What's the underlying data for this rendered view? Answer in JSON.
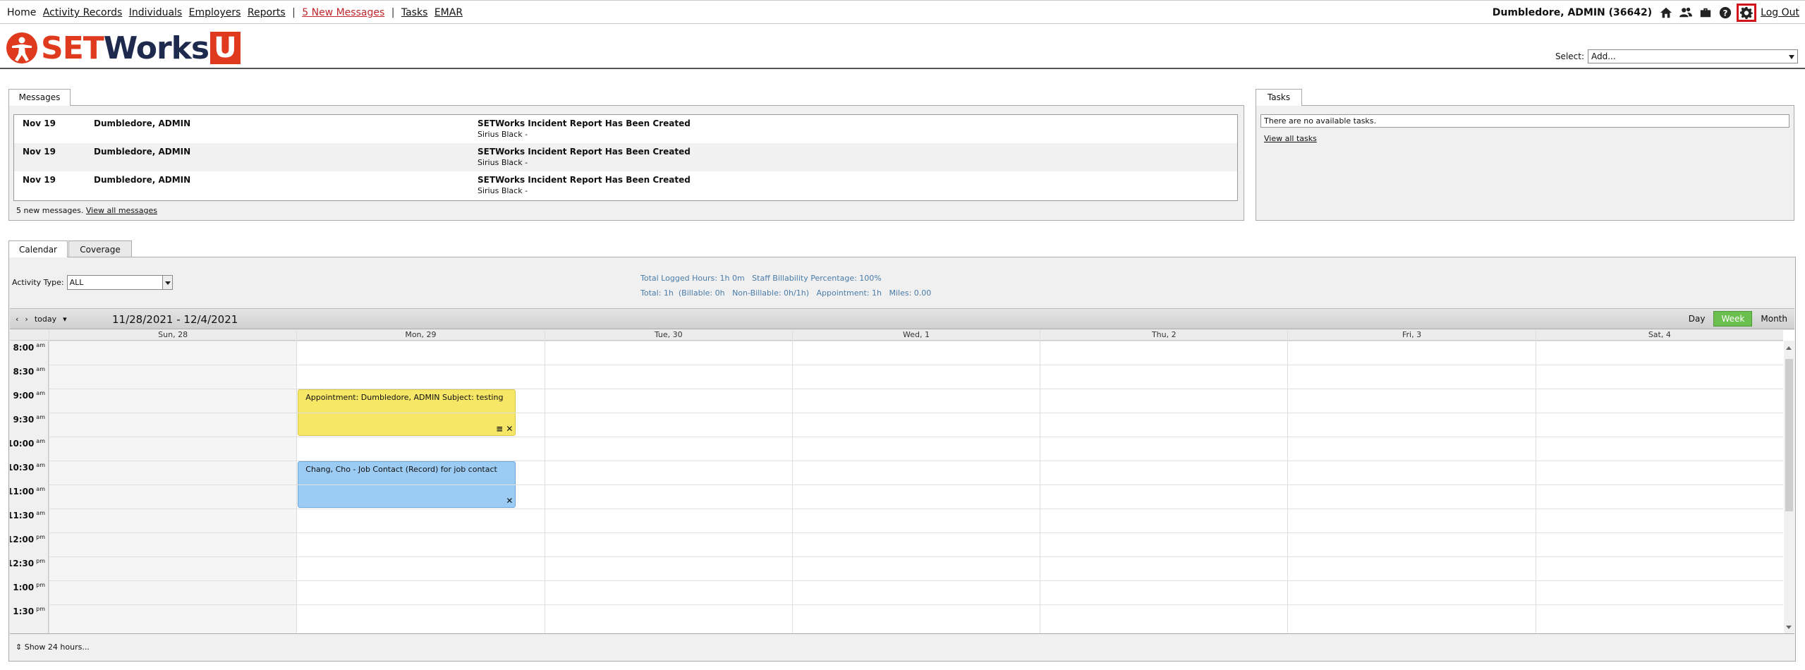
{
  "nav": {
    "home": "Home",
    "activity_records": "Activity Records",
    "individuals": "Individuals",
    "employers": "Employers",
    "reports": "Reports",
    "sep": "|",
    "new_messages": "5 New Messages",
    "tasks": "Tasks",
    "emar": "EMAR",
    "user": "Dumbledore, ADMIN  (36642)",
    "logout": "Log Out"
  },
  "header": {
    "logo_set": "SET",
    "logo_works": "Works",
    "logo_u": "U",
    "select_label": "Select:",
    "select_value": "Add..."
  },
  "messages": {
    "tab": "Messages",
    "rows": [
      {
        "date": "Nov 19",
        "from": "Dumbledore, ADMIN",
        "subject": "SETWorks Incident Report Has Been Created",
        "detail": "Sirius Black -"
      },
      {
        "date": "Nov 19",
        "from": "Dumbledore, ADMIN",
        "subject": "SETWorks Incident Report Has Been Created",
        "detail": "Sirius Black -"
      },
      {
        "date": "Nov 19",
        "from": "Dumbledore, ADMIN",
        "subject": "SETWorks Incident Report Has Been Created",
        "detail": "Sirius Black -"
      }
    ],
    "footer_text": "5 new messages.",
    "view_all": "View all messages"
  },
  "tasks": {
    "tab": "Tasks",
    "empty": "There are no available tasks.",
    "view_all": "View all tasks"
  },
  "calendar": {
    "tab_calendar": "Calendar",
    "tab_coverage": "Coverage",
    "activity_label": "Activity Type:",
    "activity_value": "ALL",
    "stats_line1": "Total Logged Hours: 1h 0m   Staff Billability Percentage: 100%",
    "stats_line2": "Total: 1h  (Billable: 0h   Non-Billable: 0h/1h)   Appointment: 1h   Miles: 0.00",
    "prev": "‹",
    "next": "›",
    "today": "today",
    "today_caret": "▾",
    "range": "11/28/2021 - 12/4/2021",
    "view_day": "Day",
    "view_week": "Week",
    "view_month": "Month",
    "days": [
      "Sun, 28",
      "Mon, 29",
      "Tue, 30",
      "Wed, 1",
      "Thu, 2",
      "Fri, 3",
      "Sat, 4"
    ],
    "times": [
      {
        "t": "8:00",
        "ap": "am"
      },
      {
        "t": "8:30",
        "ap": "am"
      },
      {
        "t": "9:00",
        "ap": "am"
      },
      {
        "t": "9:30",
        "ap": "am"
      },
      {
        "t": "10:00",
        "ap": "am"
      },
      {
        "t": "10:30",
        "ap": "am"
      },
      {
        "t": "11:00",
        "ap": "am"
      },
      {
        "t": "11:30",
        "ap": "am"
      },
      {
        "t": "12:00",
        "ap": "pm"
      },
      {
        "t": "12:30",
        "ap": "pm"
      },
      {
        "t": "1:00",
        "ap": "pm"
      },
      {
        "t": "1:30",
        "ap": "pm"
      }
    ],
    "events": [
      {
        "text": "Appointment: Dumbledore, ADMIN Subject: testing",
        "tools": "≡ ✕",
        "day": "Mon, 29",
        "start": "9:00 am",
        "end": "10:00 am",
        "color": "#f6e766"
      },
      {
        "text": "Chang, Cho - Job Contact (Record) for job contact",
        "tools": "✕",
        "day": "Mon, 29",
        "start": "10:30 am",
        "end": "11:30 am",
        "color": "#9ccbf3"
      }
    ],
    "show24_icon": "⇕",
    "show24": "Show 24 hours..."
  },
  "colors": {
    "brand_red": "#e03a1e",
    "brand_navy": "#1d2a4e",
    "new_messages": "#c0262b",
    "stats_text": "#4a7ca8",
    "week_button": "#6bbf4e",
    "gear_highlight": "#d0141a"
  },
  "icons": [
    "home-icon",
    "users-icon",
    "briefcase-icon",
    "help-icon",
    "gear-icon"
  ]
}
